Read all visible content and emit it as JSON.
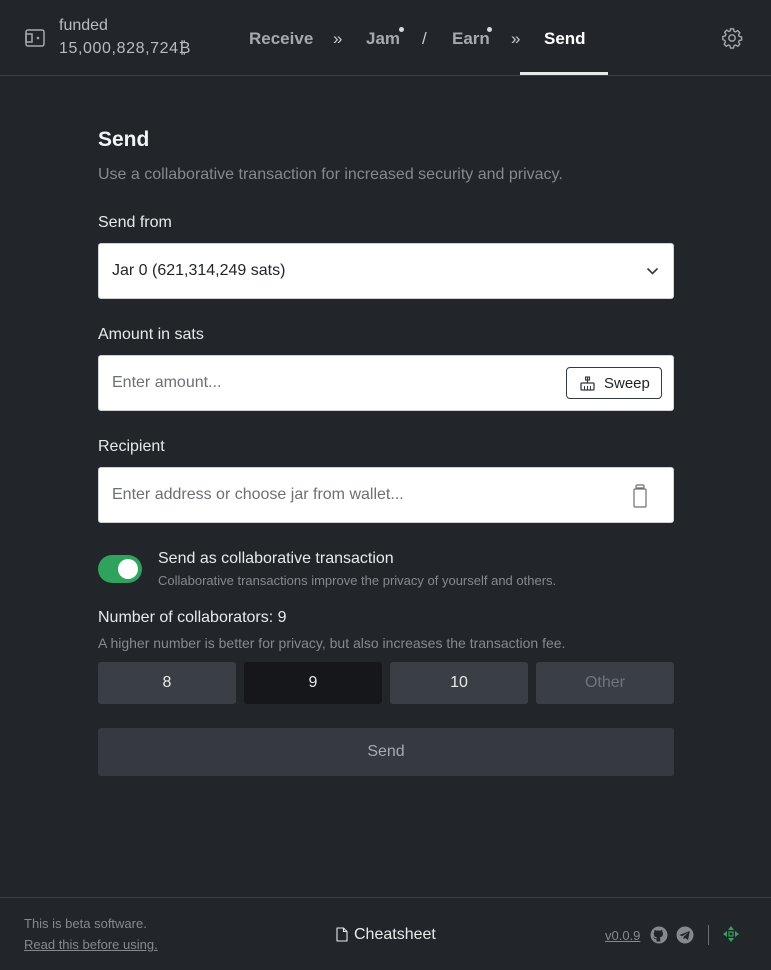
{
  "header": {
    "wallet_name": "funded",
    "wallet_balance": "15,000,828,724",
    "balance_unit": "₿",
    "nav": {
      "receive": "Receive",
      "sep1": "»",
      "jam": "Jam",
      "sep2": "/",
      "earn": "Earn",
      "sep3": "»",
      "send": "Send"
    },
    "icons": [
      "wallet-icon",
      "gear-icon"
    ]
  },
  "main": {
    "title": "Send",
    "subtitle": "Use a collaborative transaction for increased security and privacy.",
    "send_from": {
      "label": "Send from",
      "value": "Jar 0 (621,314,249 sats)"
    },
    "amount": {
      "label": "Amount in sats",
      "placeholder": "Enter amount...",
      "sweep_label": "Sweep"
    },
    "recipient": {
      "label": "Recipient",
      "placeholder": "Enter address or choose jar from wallet..."
    },
    "collaborative": {
      "title": "Send as collaborative transaction",
      "subtitle": "Collaborative transactions improve the privacy of yourself and others.",
      "enabled": true,
      "color": "#2fa35c"
    },
    "collaborators": {
      "label": "Number of collaborators: 9",
      "subtitle": "A higher number is better for privacy, but also increases the transaction fee.",
      "options": [
        "8",
        "9",
        "10",
        "Other"
      ],
      "selected": "9"
    },
    "send_button": "Send"
  },
  "footer": {
    "beta_text": "This is beta software.",
    "beta_link": "Read this before using.",
    "cheatsheet": "Cheatsheet",
    "version": "v0.0.9",
    "icons": [
      "github-icon",
      "telegram-icon",
      "joinmarket-icon"
    ]
  }
}
